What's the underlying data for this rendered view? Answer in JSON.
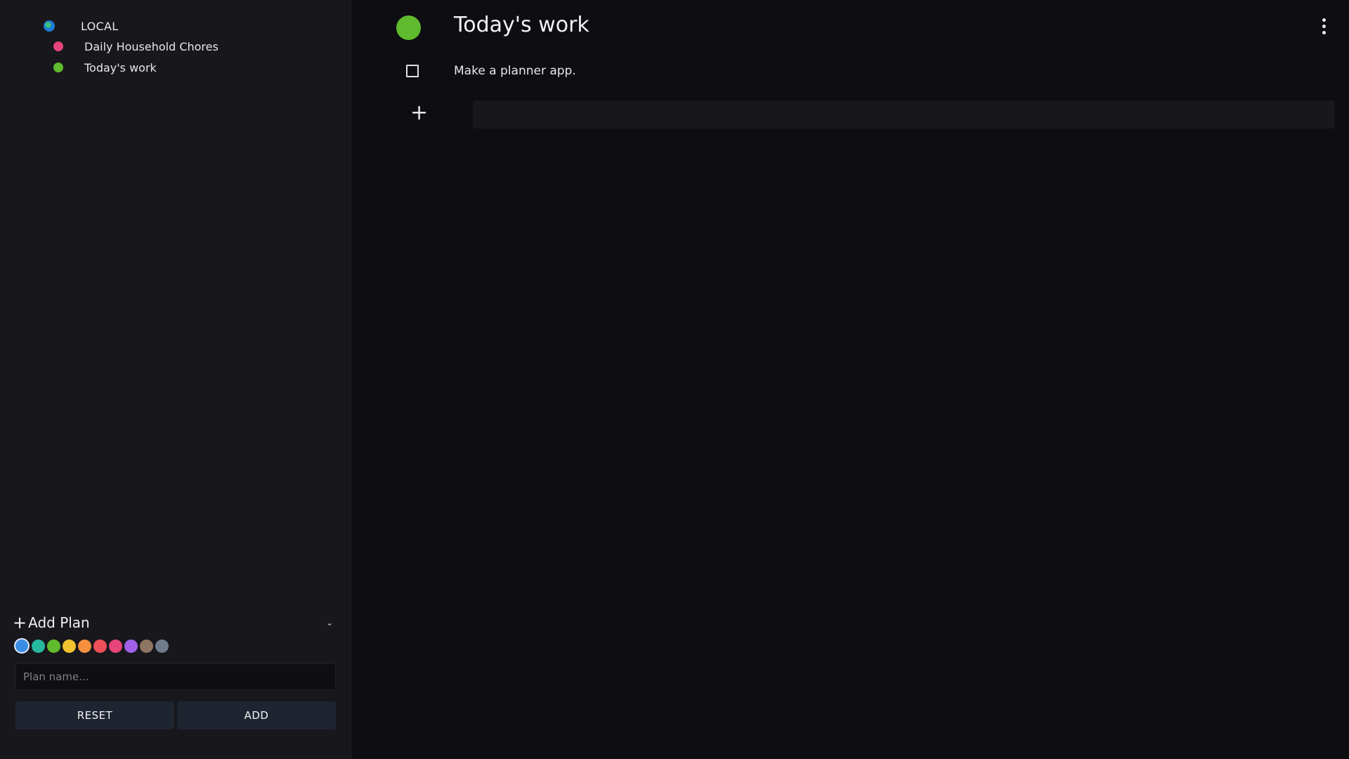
{
  "sidebar": {
    "group": {
      "label": "LOCAL",
      "icon": "globe-icon"
    },
    "plans": [
      {
        "label": "Daily Household Chores",
        "color": "#e5457a"
      },
      {
        "label": "Today's work",
        "color": "#5fbb2d"
      }
    ],
    "add_plan": {
      "title": "Add Plan",
      "placeholder": "Plan name...",
      "reset_label": "RESET",
      "add_label": "ADD",
      "swatches": [
        "#3b8de3",
        "#27b8a0",
        "#5fbb2d",
        "#f2c230",
        "#f5913e",
        "#ef4f58",
        "#e5457a",
        "#a160e6",
        "#8f7563",
        "#707c8c"
      ],
      "selected_swatch": 0
    }
  },
  "main": {
    "title": "Today's work",
    "color": "#5fbb2d",
    "tasks": [
      {
        "text": "Make a planner app.",
        "done": false
      }
    ],
    "new_task_value": ""
  }
}
